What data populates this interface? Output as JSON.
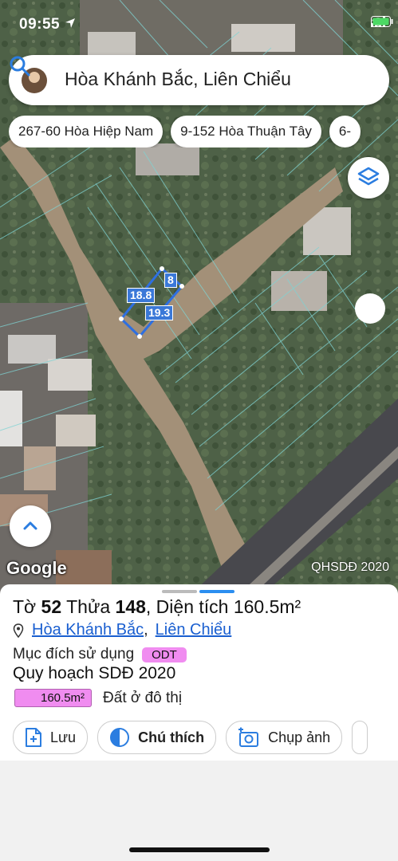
{
  "status_bar": {
    "time": "09:55",
    "icons": [
      "location-arrow-icon",
      "signal-icon",
      "wifi-icon",
      "battery-icon"
    ]
  },
  "search": {
    "query": "Hòa Khánh Bắc, Liên Chiểu"
  },
  "chips": [
    "267-60 Hòa Hiệp Nam",
    "9-152 Hòa Thuận Tây",
    "6-"
  ],
  "map": {
    "google_logo": "Google",
    "layer_name": "QHSDĐ 2020",
    "dimensions": [
      "18.8",
      "8",
      "19.3"
    ]
  },
  "parcel": {
    "title_prefix": "Tờ ",
    "sheet_no": "52",
    "title_mid": " Thửa ",
    "parcel_no": "148",
    "title_suffix": ", Diện tích 160.5m²",
    "ward": "Hòa Khánh Bắc",
    "separator": ",",
    "district": "Liên Chiểu",
    "purpose_label": "Mục đích sử dụng",
    "purpose_code": "ODT",
    "plan_label": "Quy hoạch SDĐ 2020",
    "plan_area": "160.5m²",
    "plan_desc": "Đất ở đô thị"
  },
  "actions": {
    "save": "Lưu",
    "legend": "Chú thích",
    "photo": "Chụp ảnh"
  },
  "colors": {
    "accent": "#2b8ef0",
    "odt_pink": "#f08cf0",
    "link": "#1a5fd0"
  }
}
